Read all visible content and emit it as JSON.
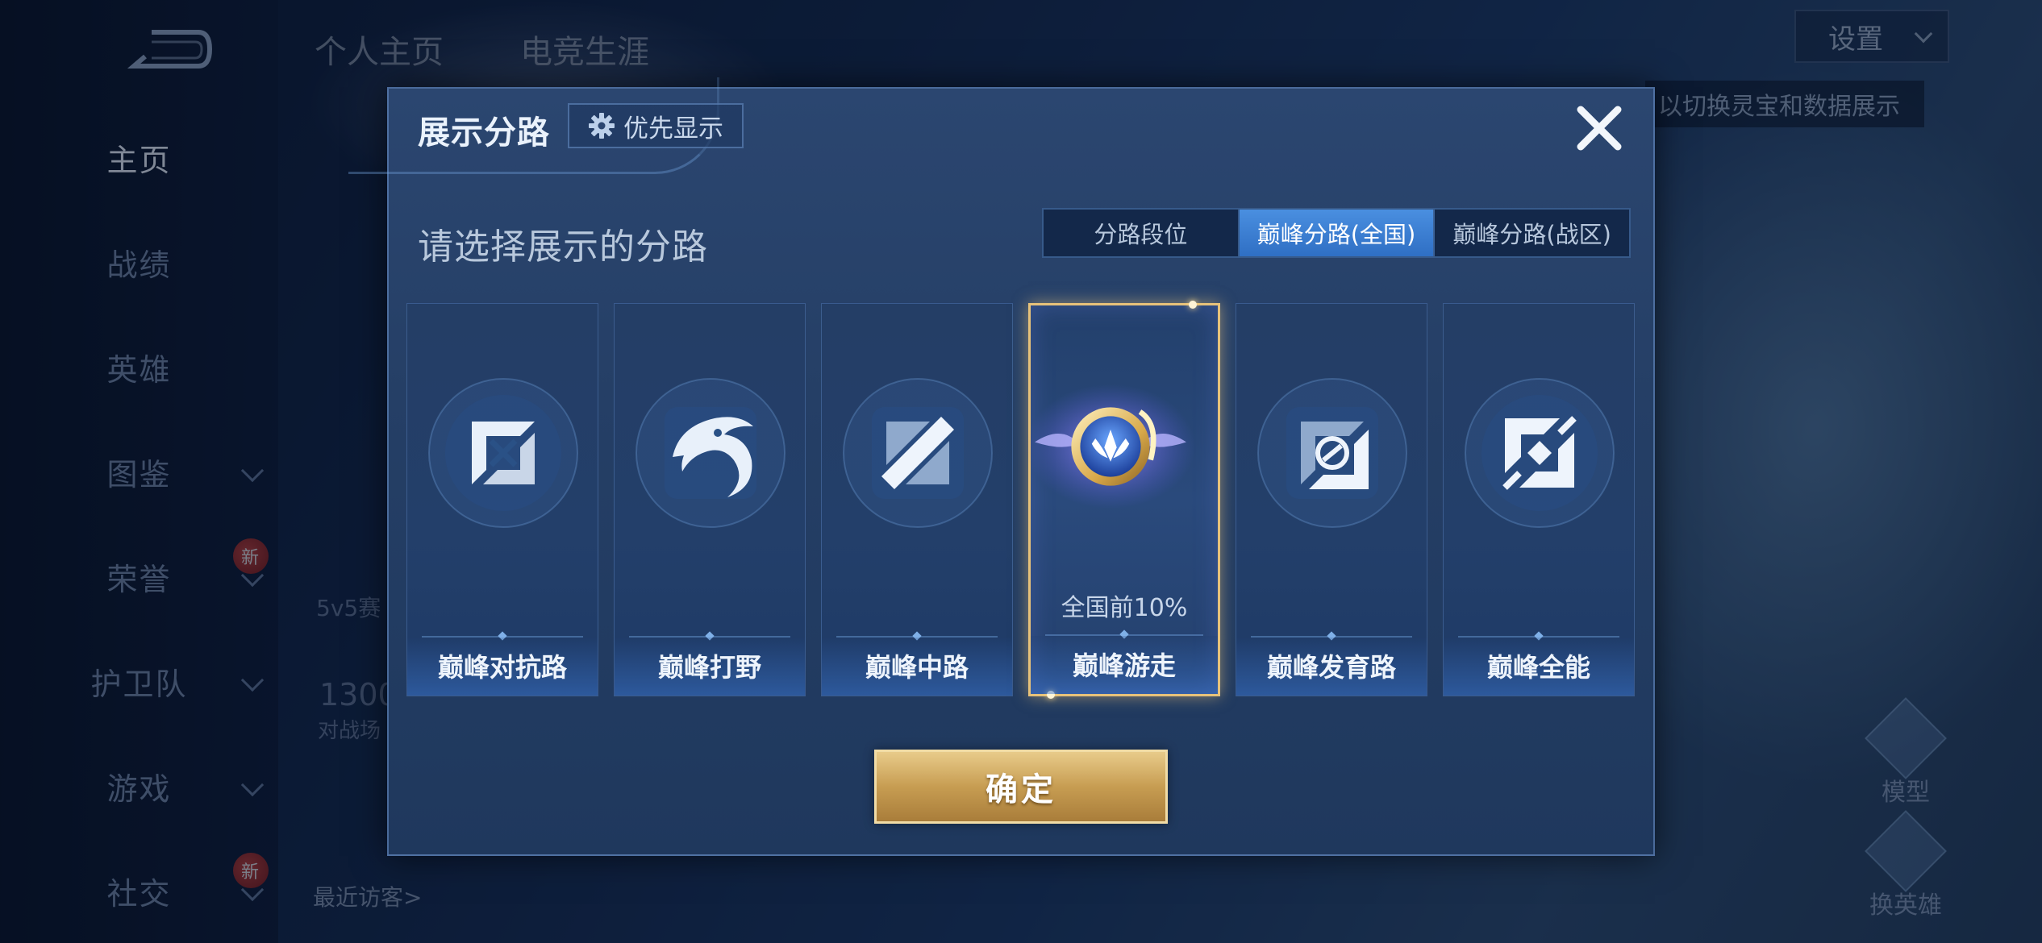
{
  "nav": {
    "items": [
      {
        "label": "主页",
        "active": true
      },
      {
        "label": "战绩"
      },
      {
        "label": "英雄"
      },
      {
        "label": "图鉴",
        "chevron": true
      },
      {
        "label": "荣誉",
        "chevron": true,
        "badge": "新"
      },
      {
        "label": "护卫队",
        "chevron": true
      },
      {
        "label": "游戏",
        "chevron": true
      },
      {
        "label": "社交",
        "chevron": true,
        "badge": "新"
      }
    ]
  },
  "header": {
    "tabs": [
      "个人主页",
      "电竞生涯"
    ],
    "settings_label": "设置",
    "hint_text": "以切换灵宝和数据展示"
  },
  "background": {
    "mode_text": "5v5赛",
    "score_text": "1300",
    "score_sub": "对战场",
    "visitors_label": "最近访客>",
    "right_actions": [
      "模型",
      "换英雄"
    ],
    "new_badge": "新"
  },
  "modal": {
    "title": "展示分路",
    "priority_button": "优先显示",
    "subtitle": "请选择展示的分路",
    "segments": [
      {
        "label": "分路段位",
        "active": false
      },
      {
        "label": "巅峰分路(全国)",
        "active": true
      },
      {
        "label": "巅峰分路(战区)",
        "active": false
      }
    ],
    "cards": [
      {
        "label": "巅峰对抗路",
        "icon": "clash-lane-icon"
      },
      {
        "label": "巅峰打野",
        "icon": "jungle-icon"
      },
      {
        "label": "巅峰中路",
        "icon": "mid-lane-icon"
      },
      {
        "label": "巅峰游走",
        "icon": "roam-icon",
        "selected": true,
        "rank": "全国前10%"
      },
      {
        "label": "巅峰发育路",
        "icon": "farm-lane-icon"
      },
      {
        "label": "巅峰全能",
        "icon": "all-round-icon"
      }
    ],
    "confirm_label": "确定"
  },
  "colors": {
    "accent_gold": "#e7c27a",
    "segment_active": "#3a7ed4",
    "modal_bg": "#253f66"
  }
}
